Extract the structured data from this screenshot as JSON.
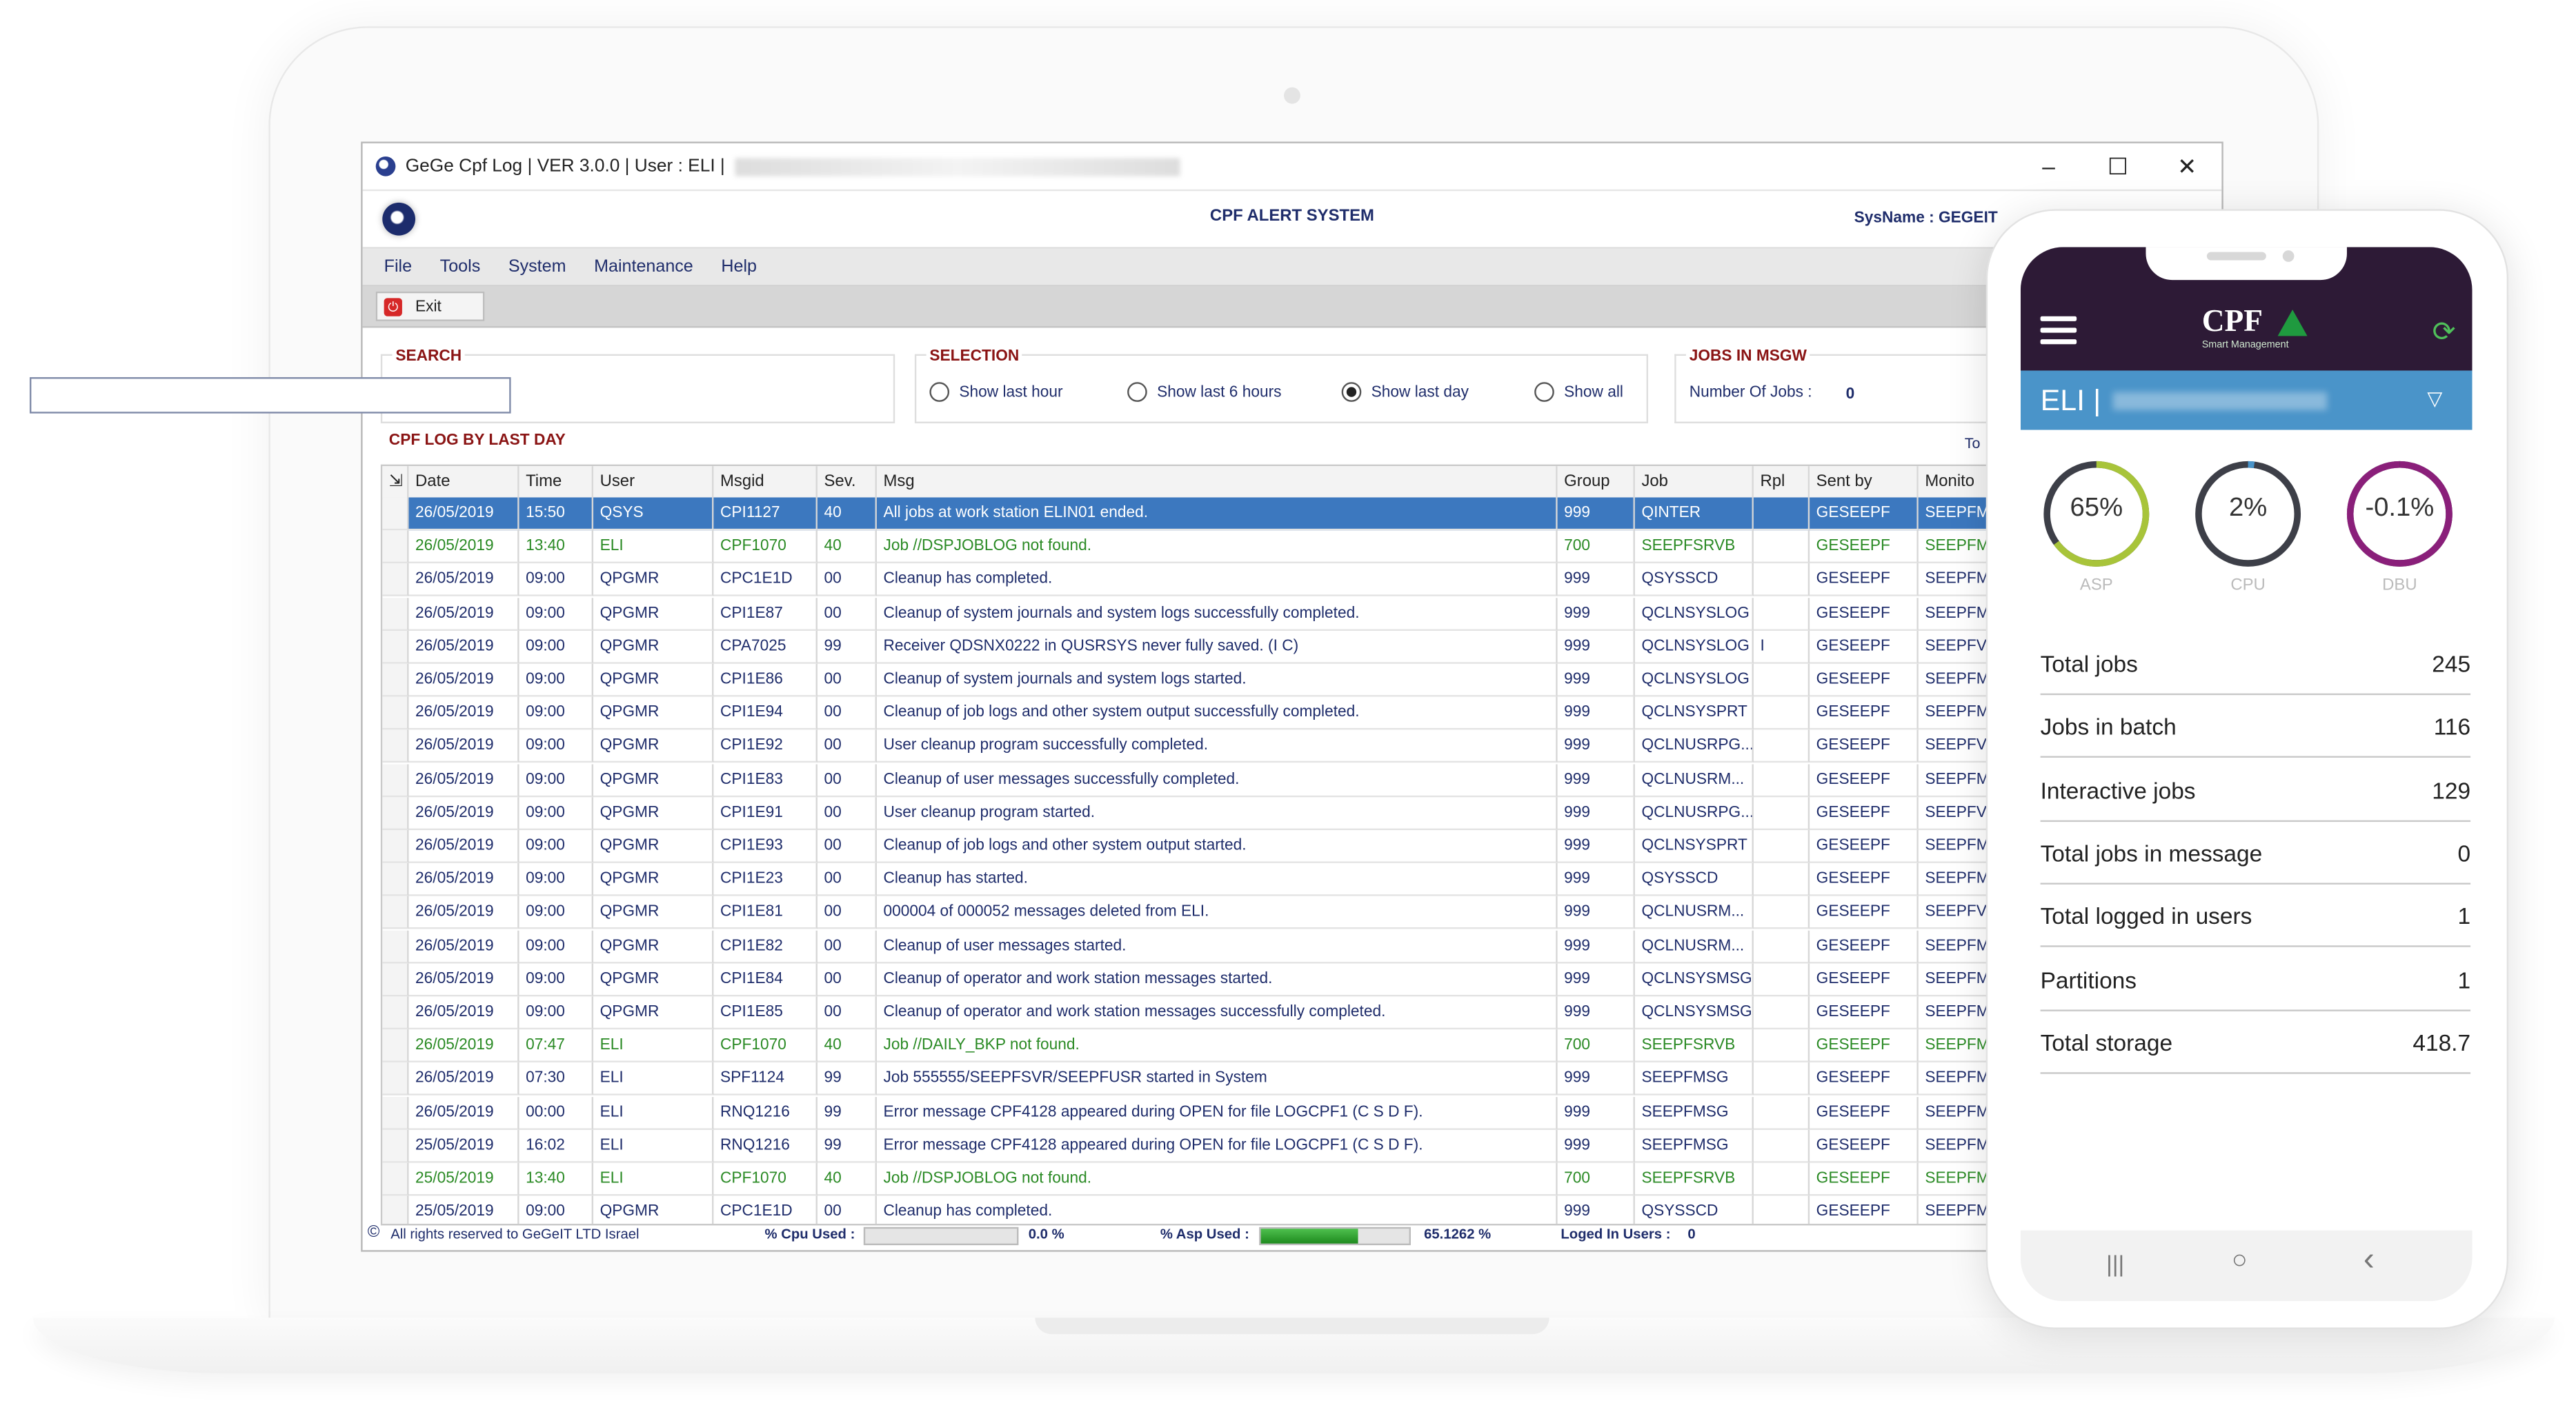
{
  "window": {
    "title": "GeGe Cpf Log | VER 3.0.0 | User : ELI |",
    "controls": {
      "minimize": "–",
      "maximize": "☐",
      "close": "✕"
    }
  },
  "header": {
    "title": "CPF ALERT SYSTEM",
    "sysname": "SysName : GEGEIT"
  },
  "menu": [
    "File",
    "Tools",
    "System",
    "Maintenance",
    "Help"
  ],
  "toolbar": {
    "exit_label": "Exit"
  },
  "search": {
    "title": "SEARCH",
    "value": ""
  },
  "selection": {
    "title": "SELECTION",
    "options": [
      "Show last hour",
      "Show last 6 hours",
      "Show last day",
      "Show all"
    ],
    "selected_index": 2
  },
  "jobs_msgw": {
    "title": "JOBS IN MSGW",
    "label": "Number Of Jobs :",
    "value": "0"
  },
  "log": {
    "title": "CPF LOG BY LAST DAY",
    "to_label": "To",
    "columns": [
      "Date",
      "Time",
      "User",
      "Msgid",
      "Sev.",
      "Msg",
      "Group",
      "Job",
      "Rpl",
      "Sent by",
      "Monito"
    ],
    "rows": [
      {
        "style": "sel",
        "c": [
          "26/05/2019",
          "15:50",
          "QSYS",
          "CPI1127",
          "40",
          "All jobs at work station ELIN01 ended.",
          "999",
          "QINTER",
          "",
          "GESEEPF",
          "SEEPFM"
        ]
      },
      {
        "style": "green",
        "c": [
          "26/05/2019",
          "13:40",
          "ELI",
          "CPF1070",
          "40",
          "Job //DSPJOBLOG not found.",
          "700",
          "SEEPFSRVB",
          "",
          "GESEEPF",
          "SEEPFM"
        ]
      },
      {
        "style": "norm",
        "c": [
          "26/05/2019",
          "09:00",
          "QPGMR",
          "CPC1E1D",
          "00",
          "Cleanup has completed.",
          "999",
          "QSYSSCD",
          "",
          "GESEEPF",
          "SEEPFM"
        ]
      },
      {
        "style": "norm",
        "c": [
          "26/05/2019",
          "09:00",
          "QPGMR",
          "CPI1E87",
          "00",
          "Cleanup of system journals and system logs successfully completed.",
          "999",
          "QCLNSYSLOG",
          "",
          "GESEEPF",
          "SEEPFM"
        ]
      },
      {
        "style": "norm",
        "c": [
          "26/05/2019",
          "09:00",
          "QPGMR",
          "CPA7025",
          "99",
          "Receiver QDSNX0222 in QUSRSYS never fully saved. (I C)",
          "999",
          "QCLNSYSLOG",
          "I",
          "GESEEPF",
          "SEEPFVF"
        ]
      },
      {
        "style": "norm",
        "c": [
          "26/05/2019",
          "09:00",
          "QPGMR",
          "CPI1E86",
          "00",
          "Cleanup of system journals and system logs started.",
          "999",
          "QCLNSYSLOG",
          "",
          "GESEEPF",
          "SEEPFM"
        ]
      },
      {
        "style": "norm",
        "c": [
          "26/05/2019",
          "09:00",
          "QPGMR",
          "CPI1E94",
          "00",
          "Cleanup of job logs and other system output successfully completed.",
          "999",
          "QCLNSYSPRT",
          "",
          "GESEEPF",
          "SEEPFM"
        ]
      },
      {
        "style": "norm",
        "c": [
          "26/05/2019",
          "09:00",
          "QPGMR",
          "CPI1E92",
          "00",
          "User cleanup program successfully completed.",
          "999",
          "QCLNUSRPG...",
          "",
          "GESEEPF",
          "SEEPFVF"
        ]
      },
      {
        "style": "norm",
        "c": [
          "26/05/2019",
          "09:00",
          "QPGMR",
          "CPI1E83",
          "00",
          "Cleanup of user messages successfully completed.",
          "999",
          "QCLNUSRM...",
          "",
          "GESEEPF",
          "SEEPFM"
        ]
      },
      {
        "style": "norm",
        "c": [
          "26/05/2019",
          "09:00",
          "QPGMR",
          "CPI1E91",
          "00",
          "User cleanup program started.",
          "999",
          "QCLNUSRPG...",
          "",
          "GESEEPF",
          "SEEPFVF"
        ]
      },
      {
        "style": "norm",
        "c": [
          "26/05/2019",
          "09:00",
          "QPGMR",
          "CPI1E93",
          "00",
          "Cleanup of job logs and other system output started.",
          "999",
          "QCLNSYSPRT",
          "",
          "GESEEPF",
          "SEEPFM"
        ]
      },
      {
        "style": "norm",
        "c": [
          "26/05/2019",
          "09:00",
          "QPGMR",
          "CPI1E23",
          "00",
          "Cleanup has started.",
          "999",
          "QSYSSCD",
          "",
          "GESEEPF",
          "SEEPFM"
        ]
      },
      {
        "style": "norm",
        "c": [
          "26/05/2019",
          "09:00",
          "QPGMR",
          "CPI1E81",
          "00",
          "000004 of 000052 messages deleted from ELI.",
          "999",
          "QCLNUSRM...",
          "",
          "GESEEPF",
          "SEEPFVF"
        ]
      },
      {
        "style": "norm",
        "c": [
          "26/05/2019",
          "09:00",
          "QPGMR",
          "CPI1E82",
          "00",
          "Cleanup of user messages started.",
          "999",
          "QCLNUSRM...",
          "",
          "GESEEPF",
          "SEEPFM"
        ]
      },
      {
        "style": "norm",
        "c": [
          "26/05/2019",
          "09:00",
          "QPGMR",
          "CPI1E84",
          "00",
          "Cleanup of operator and work station messages started.",
          "999",
          "QCLNSYSMSG",
          "",
          "GESEEPF",
          "SEEPFM"
        ]
      },
      {
        "style": "norm",
        "c": [
          "26/05/2019",
          "09:00",
          "QPGMR",
          "CPI1E85",
          "00",
          "Cleanup of operator and work station messages successfully completed.",
          "999",
          "QCLNSYSMSG",
          "",
          "GESEEPF",
          "SEEPFM"
        ]
      },
      {
        "style": "green",
        "c": [
          "26/05/2019",
          "07:47",
          "ELI",
          "CPF1070",
          "40",
          "Job //DAILY_BKP not found.",
          "700",
          "SEEPFSRVB",
          "",
          "GESEEPF",
          "SEEPFM"
        ]
      },
      {
        "style": "norm",
        "c": [
          "26/05/2019",
          "07:30",
          "ELI",
          "SPF1124",
          "99",
          "Job 555555/SEEPFSVR/SEEPFUSR started in System",
          "999",
          "SEEPFMSG",
          "",
          "GESEEPF",
          "SEEPFM"
        ]
      },
      {
        "style": "norm",
        "c": [
          "26/05/2019",
          "00:00",
          "ELI",
          "RNQ1216",
          "99",
          "Error message CPF4128 appeared during OPEN for file LOGCPF1 (C S D F).",
          "999",
          "SEEPFMSG",
          "",
          "GESEEPF",
          "SEEPFM"
        ]
      },
      {
        "style": "norm",
        "c": [
          "25/05/2019",
          "16:02",
          "ELI",
          "RNQ1216",
          "99",
          "Error message CPF4128 appeared during OPEN for file LOGCPF1 (C S D F).",
          "999",
          "SEEPFMSG",
          "",
          "GESEEPF",
          "SEEPFM"
        ]
      },
      {
        "style": "green",
        "c": [
          "25/05/2019",
          "13:40",
          "ELI",
          "CPF1070",
          "40",
          "Job //DSPJOBLOG not found.",
          "700",
          "SEEPFSRVB",
          "",
          "GESEEPF",
          "SEEPFM"
        ]
      },
      {
        "style": "norm",
        "c": [
          "25/05/2019",
          "09:00",
          "QPGMR",
          "CPC1E1D",
          "00",
          "Cleanup has completed.",
          "999",
          "QSYSSCD",
          "",
          "GESEEPF",
          "SEEPFM"
        ]
      }
    ]
  },
  "status": {
    "copyright": "All rights reserved to GeGeIT LTD  Israel",
    "cpu_label": "% Cpu Used :",
    "cpu_value": "0.0 %",
    "cpu_fraction": 0.0,
    "asp_label": "% Asp Used :",
    "asp_value": "65.1262 %",
    "asp_fraction": 0.651,
    "logged_label": "Loged In Users :",
    "logged_value": "0"
  },
  "phone": {
    "logo": "CPF",
    "logo_sub": "Smart Management",
    "user": "ELI |",
    "gauges": [
      {
        "value": "65%",
        "label": "ASP",
        "fraction": 0.65,
        "color": "#a8c43a"
      },
      {
        "value": "2%",
        "label": "CPU",
        "fraction": 0.02,
        "color": "#4a94c9"
      },
      {
        "value": "-0.1%",
        "label": "DBU",
        "fraction": 0.999,
        "color": "#8a1f7a"
      }
    ],
    "stats": [
      {
        "label": "Total jobs",
        "value": "245"
      },
      {
        "label": "Jobs in batch",
        "value": "116"
      },
      {
        "label": "Interactive jobs",
        "value": "129"
      },
      {
        "label": "Total jobs in message",
        "value": "0"
      },
      {
        "label": "Total logged in users",
        "value": "1"
      },
      {
        "label": "Partitions",
        "value": "1"
      },
      {
        "label": "Total storage",
        "value": "418.7"
      }
    ],
    "nav": [
      "|||",
      "○",
      "‹"
    ]
  }
}
